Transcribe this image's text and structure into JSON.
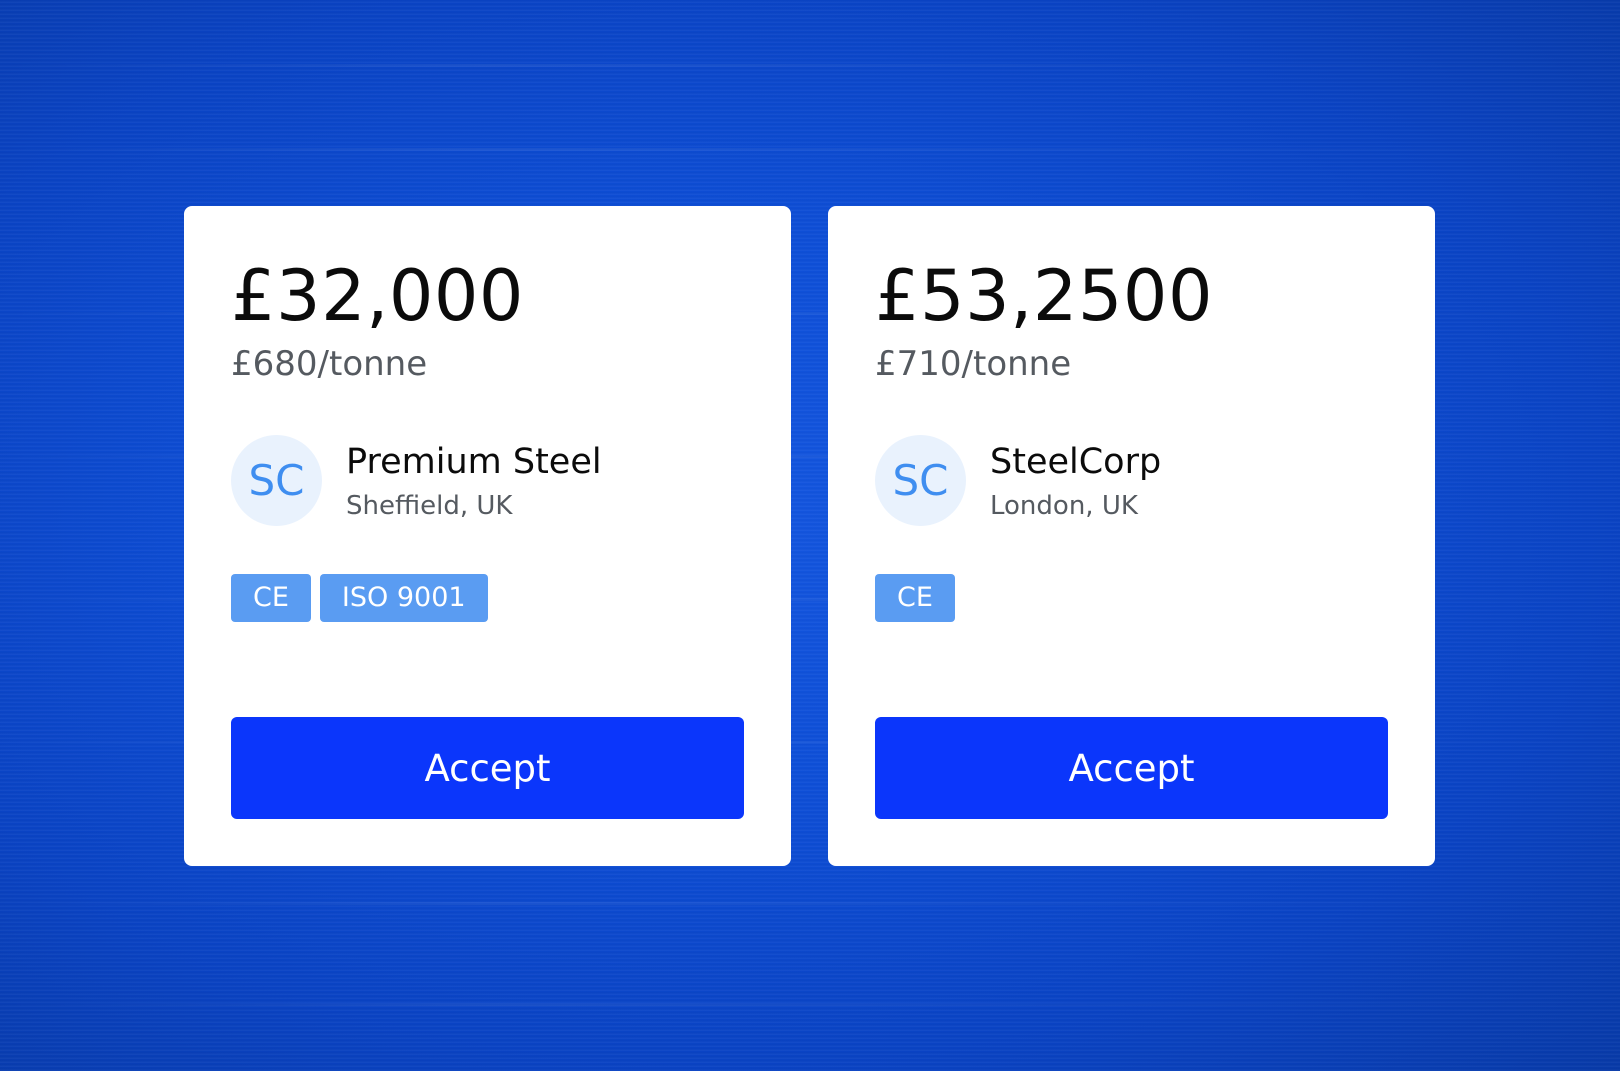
{
  "theme": {
    "accent": "#0b36fb",
    "badge_color": "#5a9cf2",
    "avatar_bg": "#e9f2fd",
    "avatar_text": "#3f8ef0",
    "background": "#0a44cc"
  },
  "offers": [
    {
      "price": "£32,000",
      "unit_price": "£680/tonne",
      "avatar_initials": "SC",
      "supplier_name": "Premium Steel",
      "supplier_location": "Sheffield, UK",
      "badges": [
        "CE",
        "ISO 9001"
      ],
      "accept_label": "Accept"
    },
    {
      "price": "£53,2500",
      "unit_price": "£710/tonne",
      "avatar_initials": "SC",
      "supplier_name": "SteelCorp",
      "supplier_location": "London, UK",
      "badges": [
        "CE"
      ],
      "accept_label": "Accept"
    }
  ]
}
